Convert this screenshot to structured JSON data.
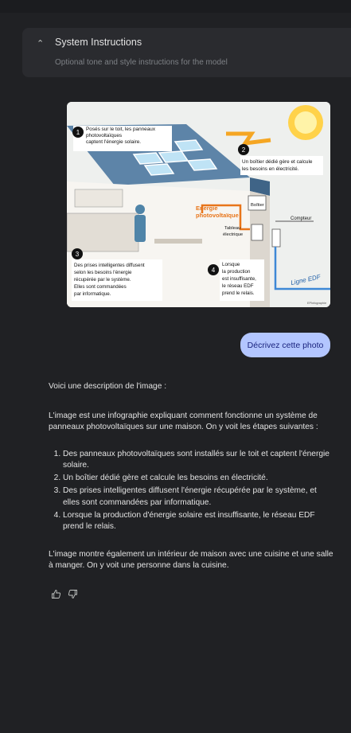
{
  "system_instructions": {
    "title": "System Instructions",
    "subtitle": "Optional tone and style instructions for the model"
  },
  "infographic": {
    "callout_1": [
      "Posés sur le toit, les panneaux",
      "photovoltaïques",
      "captent l'énergie solaire."
    ],
    "callout_2": [
      "Un boîtier dédié gère et calcule",
      "les besoins en électricité."
    ],
    "callout_3": [
      "Des prises intelligentes diffusent",
      "selon les besoins l'énergie",
      "récupérée par le système.",
      "Elles sont commandées",
      "par informatique."
    ],
    "callout_4": [
      "Lorsque",
      "la production",
      "est insuffisante,",
      "le réseau EDF",
      "prend le relais."
    ],
    "num_1": "1",
    "num_2": "2",
    "num_3": "3",
    "num_4": "4",
    "label_energy": [
      "Energie",
      "photovoltaïque"
    ],
    "label_box": "Boîtier",
    "label_panel": [
      "Tableau",
      "électrique"
    ],
    "label_meter": "Compteur",
    "label_grid": "Ligne EDF",
    "credit": "EPInfographie"
  },
  "chat": {
    "user_prompt": "Décrivez cette photo",
    "response_intro": "Voici une description de l'image :",
    "response_para1": "L'image est une infographie expliquant comment fonctionne un système de panneaux photovoltaïques sur une maison. On y voit les étapes suivantes :",
    "steps": [
      "Des panneaux photovoltaïques sont installés sur le toit et captent l'énergie solaire.",
      "Un boîtier dédié gère et calcule les besoins en électricité.",
      "Des prises intelligentes diffusent l'énergie récupérée par le système, et elles sont commandées par informatique.",
      "Lorsque la production d'énergie solaire est insuffisante, le réseau EDF prend le relais."
    ],
    "response_para2": "L'image montre également un intérieur de maison avec une cuisine et une salle à manger. On y voit une personne dans la cuisine."
  }
}
